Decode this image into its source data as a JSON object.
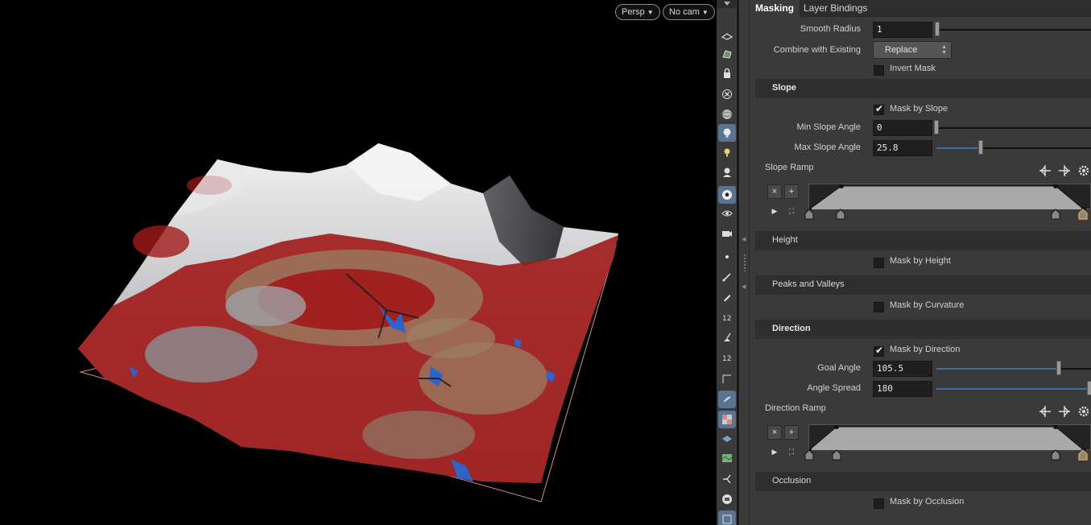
{
  "viewport": {
    "camera_mode": "Persp",
    "camera": "No cam"
  },
  "toolbar": {
    "icons": [
      "view-icon",
      "select-paint-icon",
      "lock-icon",
      "close-circle-icon",
      "sphere-icon",
      "light-icon",
      "bulb-icon",
      "head-light-icon",
      "soccer-ball-icon",
      "eye-icon",
      "camera-icon",
      "point-icon",
      "brush-icon",
      "pencil-icon",
      "number-12-icon",
      "broom-icon",
      "number-12b-icon",
      "angle-icon",
      "fin-icon",
      "checker-icon",
      "layer-icon",
      "map-icon",
      "joint-icon",
      "disc-icon",
      "frame-icon"
    ]
  },
  "tabs": [
    {
      "label": "Masking",
      "active": true
    },
    {
      "label": "Layer Bindings",
      "active": false
    }
  ],
  "params": {
    "smooth_radius": {
      "label": "Smooth Radius",
      "value": "1"
    },
    "combine": {
      "label": "Combine with Existing",
      "value": "Replace"
    },
    "invert_mask": {
      "label": "Invert Mask",
      "checked": false
    }
  },
  "slope": {
    "title": "Slope",
    "mask_by": {
      "label": "Mask by Slope",
      "checked": true
    },
    "min_angle": {
      "label": "Min Slope Angle",
      "value": "0",
      "fraction": 0.0
    },
    "max_angle": {
      "label": "Max Slope Angle",
      "value": "25.8",
      "fraction": 0.29
    },
    "ramp_label": "Slope Ramp"
  },
  "height": {
    "title": "Height",
    "mask_by": {
      "label": "Mask by Height",
      "checked": false
    }
  },
  "peaks": {
    "title": "Peaks and Valleys",
    "mask_by": {
      "label": "Mask by Curvature",
      "checked": false
    }
  },
  "direction": {
    "title": "Direction",
    "mask_by": {
      "label": "Mask by Direction",
      "checked": true
    },
    "goal_angle": {
      "label": "Goal Angle",
      "value": "105.5",
      "fraction": 0.78
    },
    "angle_spread": {
      "label": "Angle Spread",
      "value": "180",
      "fraction": 1.0
    },
    "ramp_label": "Direction Ramp"
  },
  "occlusion": {
    "title": "Occlusion",
    "mask_by": {
      "label": "Mask by Occlusion",
      "checked": false
    }
  },
  "ramp_buttons": {
    "remove": "×",
    "add": "+"
  },
  "colors": {
    "panel_bg": "#3a3a3a",
    "section_bg": "#2e2e2e",
    "slider_fill": "#3f6fa8",
    "terrain_red": "#a11a1a",
    "terrain_tan": "#9a8266",
    "terrain_blue": "#2f63c8",
    "active_tool": "#5a7390"
  }
}
